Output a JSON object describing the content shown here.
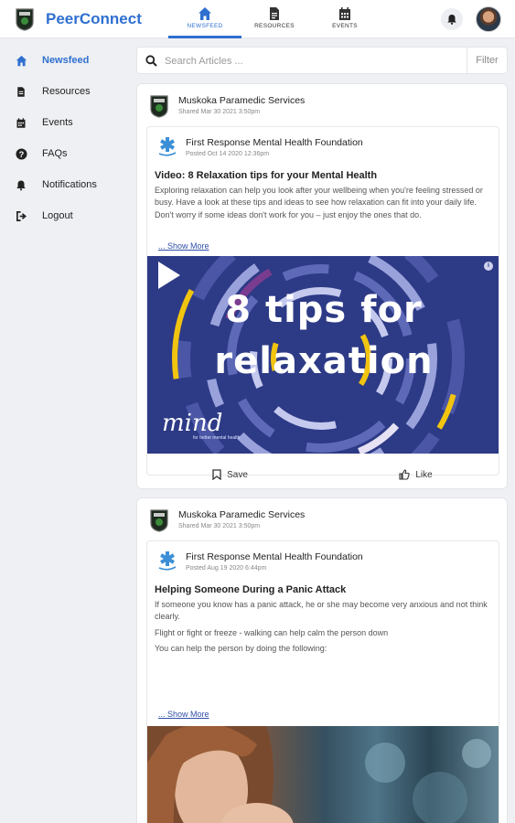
{
  "app": {
    "brand": "PeerConnect"
  },
  "top_tabs": [
    {
      "label": "NEWSFEED",
      "icon": "home-icon",
      "active": true
    },
    {
      "label": "RESOURCES",
      "icon": "document-icon",
      "active": false
    },
    {
      "label": "EVENTS",
      "icon": "calendar-icon",
      "active": false
    }
  ],
  "sidebar": {
    "items": [
      {
        "label": "Newsfeed",
        "icon": "home-icon",
        "active": true
      },
      {
        "label": "Resources",
        "icon": "document-icon"
      },
      {
        "label": "Events",
        "icon": "calendar-icon"
      },
      {
        "label": "FAQs",
        "icon": "question-icon"
      },
      {
        "label": "Notifications",
        "icon": "bell-icon"
      },
      {
        "label": "Logout",
        "icon": "logout-icon"
      }
    ]
  },
  "search": {
    "placeholder": "Search Articles ...",
    "value": "",
    "filter_label": "Filter"
  },
  "posts": [
    {
      "org": "Muskoka Paramedic Services",
      "shared": "Shared Mar 30 2021 3:50pm",
      "source": "First Response Mental Health Foundation",
      "posted": "Posted Oct 14 2020 12:36pm",
      "title": "Video: 8 Relaxation tips for your Mental Health",
      "body": "Exploring relaxation can help you look after your wellbeing when you're feeling stressed or busy. Have a look at these tips and ideas to see how relaxation can fit into your daily life. Don't worry if some ideas don't work for you – just enjoy the ones that do.",
      "show_more": "... Show More",
      "video_line1": "8 tips for",
      "video_line2": "relaxation",
      "video_brand": "mind",
      "video_brand_sub": "for better mental health",
      "save_label": "Save",
      "like_label": "Like"
    },
    {
      "org": "Muskoka Paramedic Services",
      "shared": "Shared Mar 30 2021 3:50pm",
      "source": "First Response Mental Health Foundation",
      "posted": "Posted Aug 19 2020 6:44pm",
      "title": "Helping Someone During a Panic Attack",
      "body1": "If someone you know has a panic attack, he or she may become very anxious and not think clearly.",
      "body2": "Flight or fight or freeze - walking can help calm the person down",
      "body3": "You can help the person by doing the following:",
      "show_more": "... Show More"
    }
  ],
  "colors": {
    "accent": "#2f6fcf",
    "video_bg": "#2d3a86"
  }
}
